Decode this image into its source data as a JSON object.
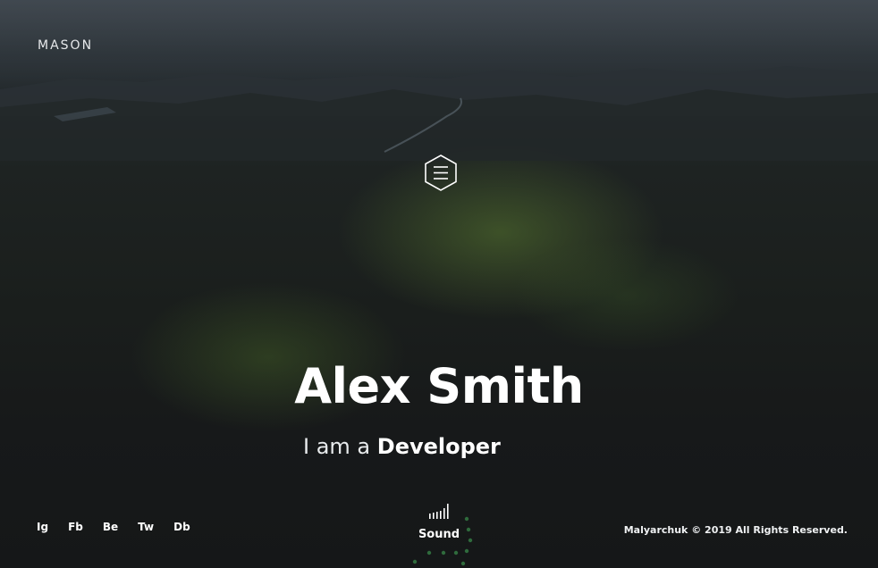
{
  "brand": {
    "logo_text": "MASON"
  },
  "menu": {
    "icon": "hamburger-hexagon-icon"
  },
  "hero": {
    "title": "Alex Smith",
    "subtitle_prefix": "I am a ",
    "subtitle_role": "Developer"
  },
  "social": {
    "links": [
      {
        "label": "Ig"
      },
      {
        "label": "Fb"
      },
      {
        "label": "Be"
      },
      {
        "label": "Tw"
      },
      {
        "label": "Db"
      }
    ]
  },
  "sound": {
    "label": "Sound",
    "icon": "equalizer-bars-icon"
  },
  "footer": {
    "copyright": "Malyarchuk © 2019 All Rights Reserved."
  },
  "colors": {
    "text": "#ffffff",
    "accent_dots": "#2f6b3c",
    "background_dark": "#16191b"
  }
}
